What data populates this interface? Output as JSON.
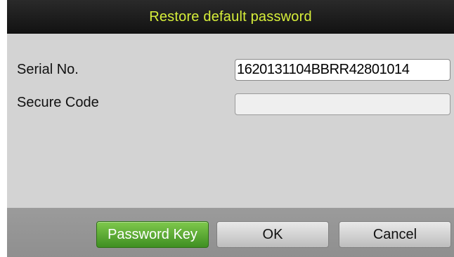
{
  "dialog": {
    "title": "Restore default password",
    "fields": [
      {
        "label": "Serial No.",
        "value": "1620131104BBRR42801014"
      },
      {
        "label": "Secure Code",
        "value": ""
      }
    ],
    "buttons": {
      "password_key": "Password Key",
      "ok": "OK",
      "cancel": "Cancel"
    }
  },
  "colors": {
    "title_text": "#d7ef3a",
    "titlebar_bg": "#1a1a1a",
    "body_bg": "#d3d3d3",
    "footer_bg": "#959595",
    "primary_button": "#4fa52f"
  }
}
